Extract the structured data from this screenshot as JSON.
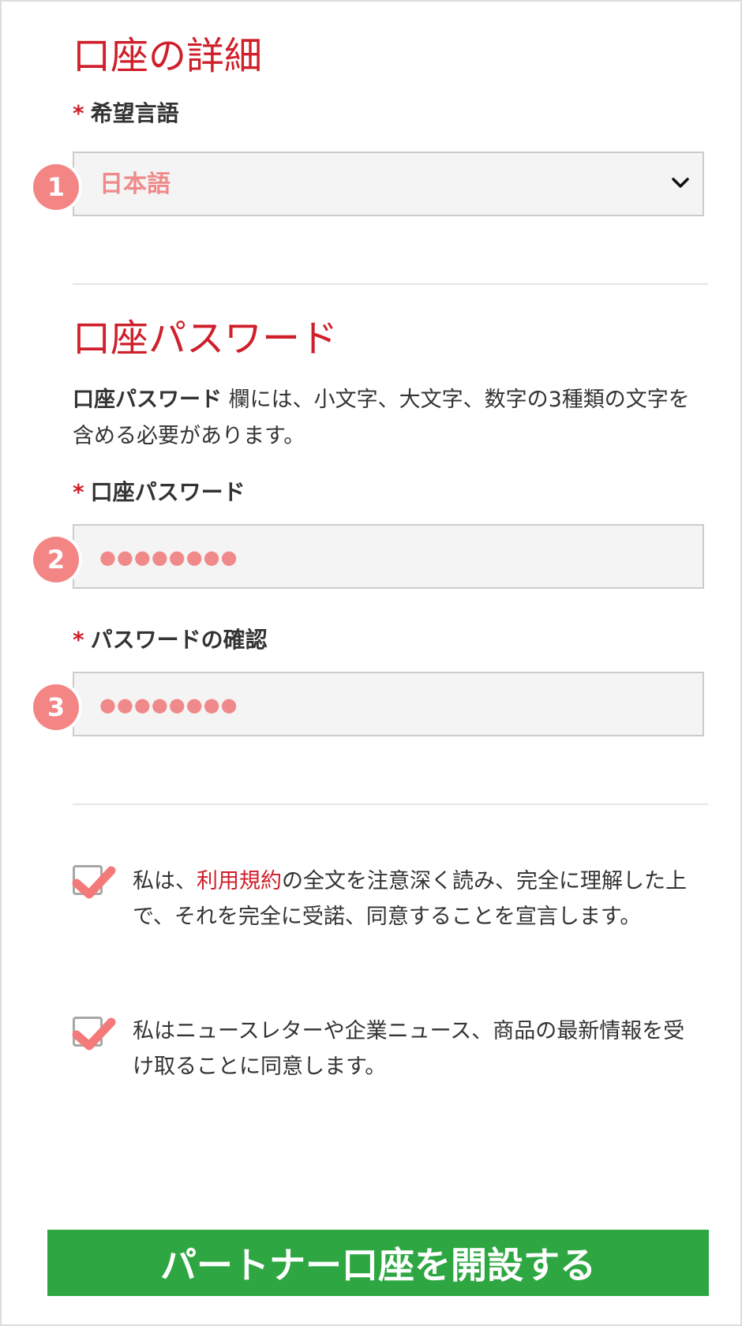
{
  "account_details": {
    "title": "口座の詳細",
    "required_mark": "*",
    "language_label": "希望言語",
    "language_value": "日本語",
    "marker": "1"
  },
  "account_password": {
    "title": "口座パスワード",
    "description_bold": "口座パスワード",
    "description_rest": " 欄には、小文字、大文字、数字の3種類の文字を含める必要があります。",
    "password_label": "口座パスワード",
    "password_value": "●●●●●●●●",
    "password_marker": "2",
    "confirm_label": "パスワードの確認",
    "confirm_value": "●●●●●●●●",
    "confirm_marker": "3"
  },
  "agreements": {
    "terms_prefix": "私は、",
    "terms_link": "利用規約",
    "terms_suffix": "の全文を注意深く読み、完全に理解した上で、それを完全に受諾、同意することを宣言します。",
    "terms_checked": true,
    "newsletter_text": "私はニュースレターや企業ニュース、商品の最新情報を受け取ることに同意します。",
    "newsletter_checked": true
  },
  "submit": {
    "label": "パートナー口座を開設する"
  },
  "colors": {
    "accent_red": "#cf1f2a",
    "marker_pink": "#f48585",
    "button_green": "#2ea743"
  }
}
